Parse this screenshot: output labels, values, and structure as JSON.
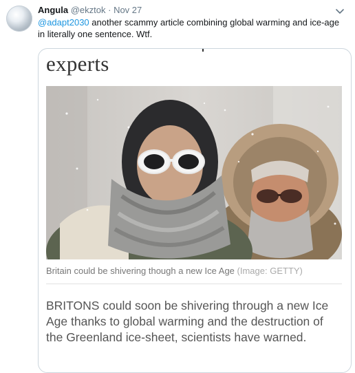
{
  "tweet": {
    "author_name": "Angula",
    "author_handle": "@ekztok",
    "separator": "·",
    "date": "Nov 27",
    "mention": "@adapt2030",
    "text": " another scammy article combining global warming and ice-age in literally one sentence. Wtf."
  },
  "card": {
    "headline": "experts",
    "caption": "Britain could be shivering though a new Ice Age",
    "credit": "(Image: GETTY)",
    "body": "BRITONS could soon be shivering through a new Ice Age thanks to global warming and the destruction of the Greenland ice-sheet, scientists have warned."
  },
  "icons": {
    "menu": "chevron-down-icon",
    "avatar": "snowball-avatar"
  },
  "colors": {
    "link": "#1b95e0",
    "secondary_text": "#657786",
    "card_border": "#ccd6dd"
  }
}
